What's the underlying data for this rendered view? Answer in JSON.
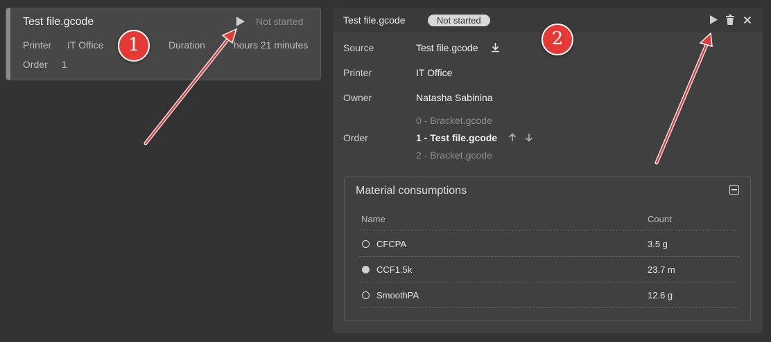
{
  "card": {
    "title": "Test file.gcode",
    "status": "Not started",
    "printer_label": "Printer",
    "printer_value": "IT Office",
    "duration_label": "Duration",
    "duration_value": "hours 21 minutes",
    "order_label": "Order",
    "order_value": "1"
  },
  "panel": {
    "title": "Test file.gcode",
    "status_badge": "Not started",
    "source_label": "Source",
    "source_value": "Test file.gcode",
    "printer_label": "Printer",
    "printer_value": "IT Office",
    "owner_label": "Owner",
    "owner_value": "Natasha Sabinina",
    "order_label": "Order",
    "order_list": [
      {
        "label": "0 - Bracket.gcode"
      },
      {
        "label": "1 - Test file.gcode"
      },
      {
        "label": "2 - Bracket.gcode"
      }
    ]
  },
  "materials": {
    "title": "Material consumptions",
    "columns": {
      "name": "Name",
      "count": "Count"
    },
    "rows": [
      {
        "name": "CFCPA",
        "count": "3.5 g",
        "icon": "circle-outline-icon"
      },
      {
        "name": "CCF1.5k",
        "count": "23.7 m",
        "icon": "circle-filled-icon"
      },
      {
        "name": "SmoothPA",
        "count": "12.6 g",
        "icon": "circle-outline-icon"
      }
    ]
  },
  "callouts": {
    "one": "1",
    "two": "2"
  },
  "colors": {
    "callout": "#e53935",
    "background": "#333333",
    "badge": "#d9d9d9"
  }
}
